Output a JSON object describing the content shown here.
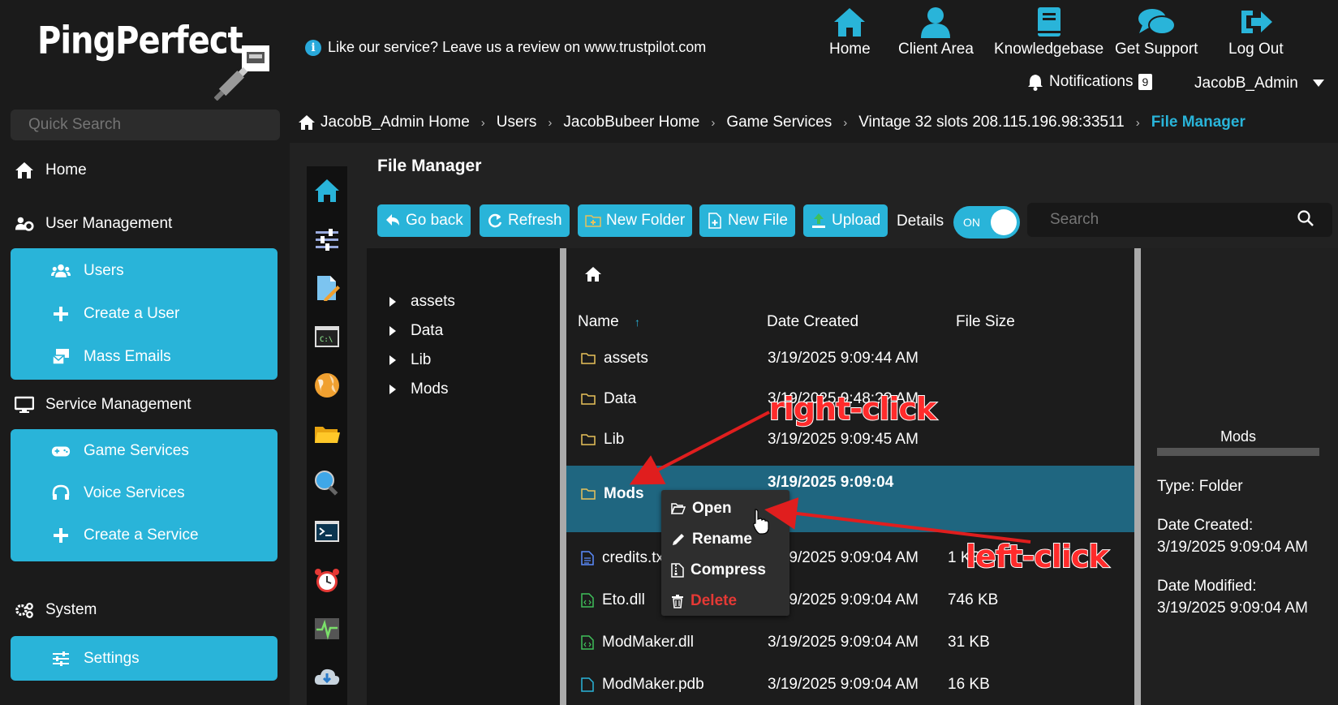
{
  "brand": {
    "name": "PingPerfect"
  },
  "info_bar": {
    "text": "Like our service? Leave us a review on www.trustpilot.com"
  },
  "top_nav": [
    {
      "label": "Home",
      "icon": "home-icon"
    },
    {
      "label": "Client Area",
      "icon": "user-icon"
    },
    {
      "label": "Knowledgebase",
      "icon": "book-icon"
    },
    {
      "label": "Get Support",
      "icon": "chat-icon"
    },
    {
      "label": "Log Out",
      "icon": "logout-icon"
    }
  ],
  "notifications": {
    "label": "Notifications",
    "count": "9"
  },
  "user": {
    "name": "JacobB_Admin"
  },
  "sidebar": {
    "search_placeholder": "Quick Search",
    "home": "Home",
    "user_mgmt": "User Management",
    "users": "Users",
    "create_user": "Create a User",
    "mass_emails": "Mass Emails",
    "service_mgmt": "Service Management",
    "game_services": "Game Services",
    "voice_services": "Voice Services",
    "create_service": "Create a Service",
    "system": "System",
    "settings": "Settings"
  },
  "breadcrumb": [
    "JacobB_Admin Home",
    "Users",
    "JacobBubeer Home",
    "Game Services",
    "Vintage 32 slots 208.115.196.98:33511",
    "File Manager"
  ],
  "file_manager": {
    "title": "File Manager",
    "buttons": {
      "go_back": "Go back",
      "refresh": "Refresh",
      "new_folder": "New Folder",
      "new_file": "New File",
      "upload": "Upload"
    },
    "details_label": "Details",
    "toggle_state": "ON",
    "search_placeholder": "Search",
    "tree": [
      "assets",
      "Data",
      "Lib",
      "Mods"
    ],
    "columns": {
      "name": "Name",
      "date": "Date Created",
      "size": "File Size"
    },
    "rows": [
      {
        "name": "assets",
        "type": "folder",
        "date": "3/19/2025 9:09:44 AM",
        "size": ""
      },
      {
        "name": "Data",
        "type": "folder",
        "date": "3/19/2025 9:48:?? AM",
        "size": ""
      },
      {
        "name": "Lib",
        "type": "folder",
        "date": "3/19/2025 9:09:45 AM",
        "size": ""
      },
      {
        "name": "Mods",
        "type": "folder",
        "date": "3/19/2025 9:09:04",
        "size": "",
        "selected": true
      },
      {
        "name": "credits.txt",
        "type": "text",
        "date": "3/19/2025 9:09:04 AM",
        "size": "1 KB"
      },
      {
        "name": "Eto.dll",
        "type": "code",
        "date": "3/19/2025 9:09:04 AM",
        "size": "746 KB"
      },
      {
        "name": "ModMaker.dll",
        "type": "code",
        "date": "3/19/2025 9:09:04 AM",
        "size": "31 KB"
      },
      {
        "name": "ModMaker.pdb",
        "type": "file",
        "date": "3/19/2025 9:09:04 AM",
        "size": "16 KB"
      }
    ],
    "context_menu": [
      "Open",
      "Rename",
      "Compress",
      "Delete"
    ],
    "details_panel": {
      "name": "Mods",
      "type": "Type: Folder",
      "created_label": "Date Created:",
      "created": "3/19/2025 9:09:04 AM",
      "modified_label": "Date Modified:",
      "modified": "3/19/2025 9:09:04 AM"
    }
  },
  "annotations": {
    "right_click": "right-click",
    "left_click": "left-click"
  },
  "colors": {
    "accent": "#29b4d9",
    "background": "#1b1b1b",
    "selected_row": "#1f6680",
    "annotation": "#ff2b2b",
    "delete": "#e53935"
  }
}
